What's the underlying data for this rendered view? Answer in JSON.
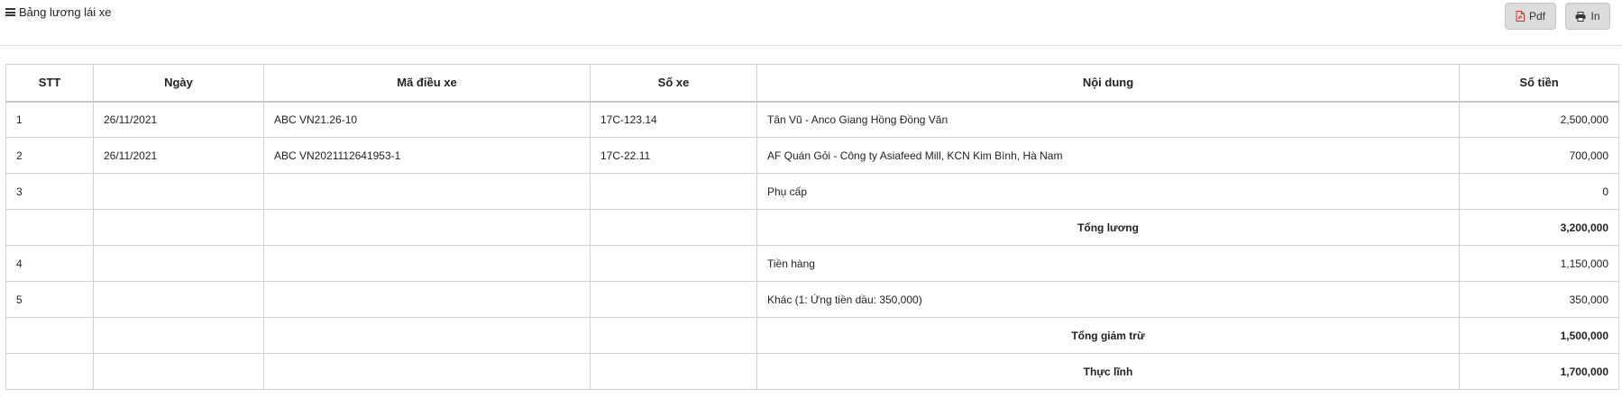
{
  "header": {
    "title": "Bảng lương lái xe",
    "pdf_label": "Pdf",
    "print_label": "In"
  },
  "table": {
    "columns": [
      "STT",
      "Ngày",
      "Mã điều xe",
      "Số xe",
      "Nội dung",
      "Số tiền"
    ],
    "rows": [
      {
        "stt": "1",
        "date": "26/11/2021",
        "code": "ABC VN21.26-10",
        "plate": "17C-123.14",
        "content": "Tân Vũ - Anco Giang Hồng Đồng Văn",
        "amount": "2,500,000"
      },
      {
        "stt": "2",
        "date": "26/11/2021",
        "code": "ABC VN2021112641953-1",
        "plate": "17C-22.11",
        "content": "AF Quán Gỏi - Công ty Asiafeed Mill, KCN Kim Bình, Hà Nam",
        "amount": "700,000"
      },
      {
        "stt": "3",
        "date": "",
        "code": "",
        "plate": "",
        "content": "Phụ cấp",
        "amount": "0"
      },
      {
        "stt": "",
        "date": "",
        "code": "",
        "plate": "",
        "content": "Tổng lương",
        "amount": "3,200,000",
        "summary": true
      },
      {
        "stt": "4",
        "date": "",
        "code": "",
        "plate": "",
        "content": "Tiền hàng",
        "amount": "1,150,000"
      },
      {
        "stt": "5",
        "date": "",
        "code": "",
        "plate": "",
        "content": "Khác (1: Ứng tiền dầu: 350,000)",
        "amount": "350,000"
      },
      {
        "stt": "",
        "date": "",
        "code": "",
        "plate": "",
        "content": "Tổng giảm trừ",
        "amount": "1,500,000",
        "summary": true
      },
      {
        "stt": "",
        "date": "",
        "code": "",
        "plate": "",
        "content": "Thực lĩnh",
        "amount": "1,700,000",
        "summary": true
      }
    ]
  },
  "icons": {
    "title_icon": "bars-icon",
    "pdf_icon": "file-pdf-icon",
    "print_icon": "print-icon"
  }
}
